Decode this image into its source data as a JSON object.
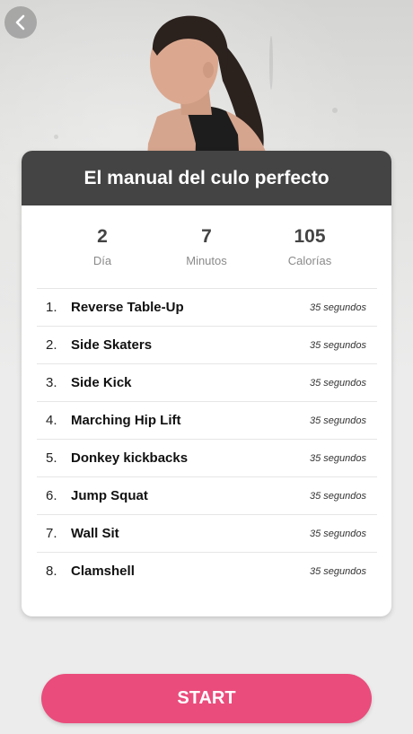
{
  "header": {
    "back_icon": "chevron-left-icon"
  },
  "card": {
    "title": "El manual del culo perfecto",
    "stats": [
      {
        "value": "2",
        "label": "Día"
      },
      {
        "value": "7",
        "label": "Minutos"
      },
      {
        "value": "105",
        "label": "Calorías"
      }
    ],
    "exercises": [
      {
        "num": "1.",
        "name": "Reverse Table-Up",
        "duration": "35 segundos"
      },
      {
        "num": "2.",
        "name": "Side Skaters",
        "duration": "35 segundos"
      },
      {
        "num": "3.",
        "name": "Side Kick",
        "duration": "35 segundos"
      },
      {
        "num": "4.",
        "name": "Marching Hip Lift",
        "duration": "35 segundos"
      },
      {
        "num": "5.",
        "name": "Donkey kickbacks",
        "duration": "35 segundos"
      },
      {
        "num": "6.",
        "name": "Jump Squat",
        "duration": "35 segundos"
      },
      {
        "num": "7.",
        "name": "Wall Sit",
        "duration": "35 segundos"
      },
      {
        "num": "8.",
        "name": "Clamshell",
        "duration": "35 segundos"
      }
    ]
  },
  "start_button": {
    "label": "START"
  },
  "colors": {
    "header": "#444444",
    "accent": "#ea4c7c",
    "background": "#ececec"
  }
}
